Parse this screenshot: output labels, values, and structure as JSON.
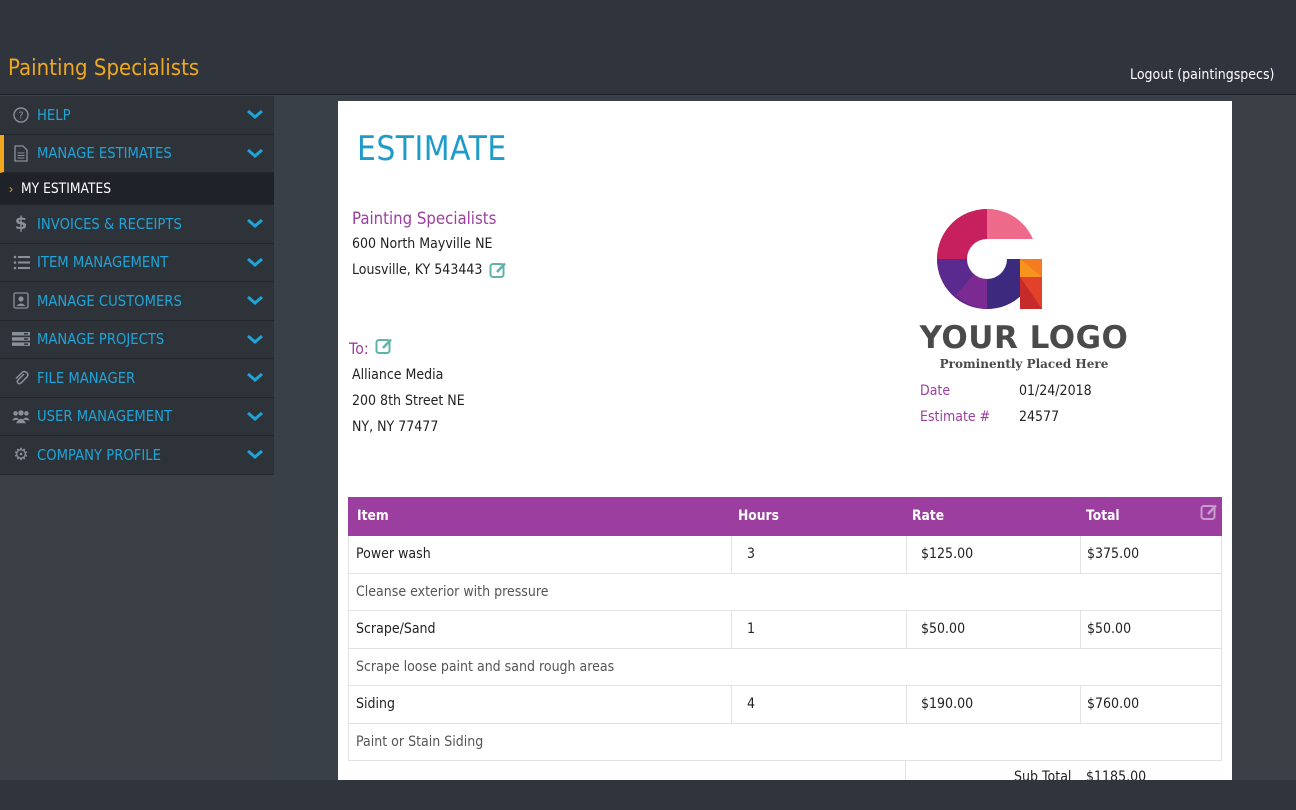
{
  "app": {
    "brand": "Painting Specialists",
    "logout": "Logout (paintingspecs)"
  },
  "sidebar": {
    "items": [
      {
        "label": "HELP",
        "icon": "help-circle-icon"
      },
      {
        "label": "MANAGE ESTIMATES",
        "icon": "document-icon"
      },
      {
        "label": "INVOICES & RECEIPTS",
        "icon": "dollar-icon"
      },
      {
        "label": "ITEM MANAGEMENT",
        "icon": "list-icon"
      },
      {
        "label": "MANAGE CUSTOMERS",
        "icon": "customer-card-icon"
      },
      {
        "label": "MANAGE PROJECTS",
        "icon": "projects-icon"
      },
      {
        "label": "FILE MANAGER",
        "icon": "paperclip-icon"
      },
      {
        "label": "USER MANAGEMENT",
        "icon": "users-icon"
      },
      {
        "label": "COMPANY PROFILE",
        "icon": "gear-icon"
      }
    ],
    "submenu": {
      "label": "MY ESTIMATES"
    },
    "accent": "#f0a81e",
    "link_color": "#1ea4d8"
  },
  "estimate": {
    "title": "ESTIMATE",
    "from": {
      "company": "Painting Specialists",
      "line1": "600 North Mayville NE",
      "line2": "Lousville, KY 543443"
    },
    "to_label": "To:",
    "to": {
      "name": "Alliance Media",
      "line1": "200 8th Street NE",
      "line2": "NY, NY 77477"
    },
    "logo": {
      "text": "YOUR LOGO",
      "tagline": "Prominently Placed Here"
    },
    "meta": {
      "date_label": "Date",
      "date": "01/24/2018",
      "number_label": "Estimate #",
      "number": "24577"
    },
    "table": {
      "headers": [
        "Item",
        "Hours",
        "Rate",
        "Total"
      ],
      "items": [
        {
          "item": "Power wash",
          "hours": "3",
          "rate": "$125.00",
          "total": "$375.00",
          "description": "Cleanse exterior with pressure"
        },
        {
          "item": "Scrape/Sand",
          "hours": "1",
          "rate": "$50.00",
          "total": "$50.00",
          "description": "Scrape loose paint and sand rough areas"
        },
        {
          "item": "Siding",
          "hours": "4",
          "rate": "$190.00",
          "total": "$760.00",
          "description": "Paint or Stain Siding"
        }
      ],
      "subtotal_label": "Sub Total",
      "subtotal": "$1185.00"
    },
    "accent": "#9c3ea0",
    "title_color": "#1d9bc9"
  }
}
